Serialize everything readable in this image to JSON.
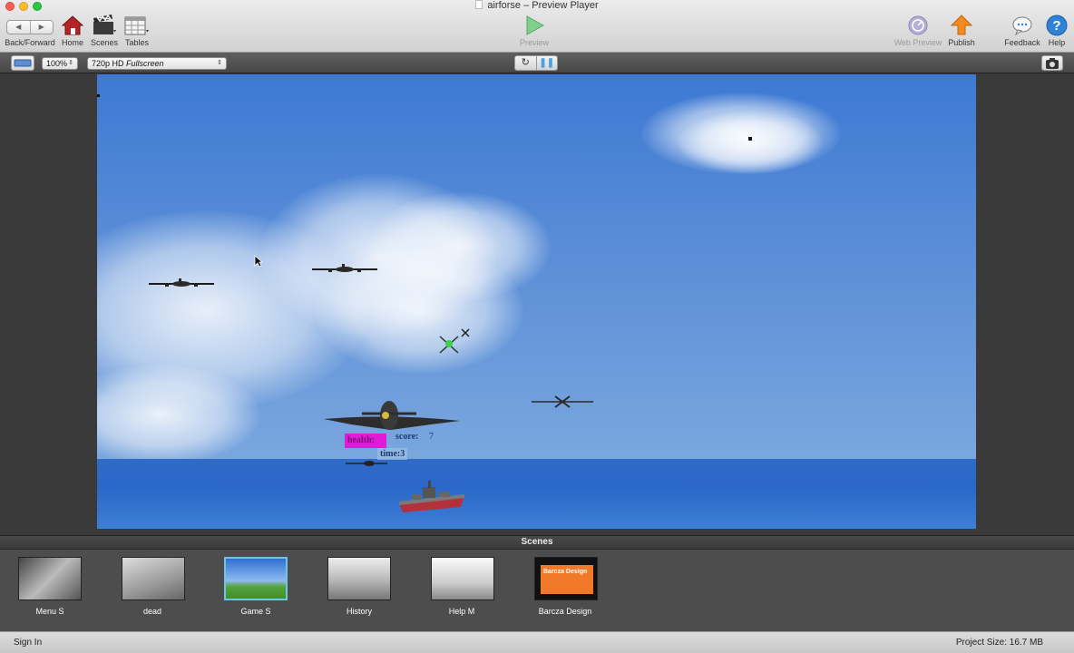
{
  "window": {
    "title": "airforse – Preview Player"
  },
  "toolbar": {
    "back_forward_label": "Back/Forward",
    "home_label": "Home",
    "scenes_label": "Scenes",
    "tables_label": "Tables",
    "preview_label": "Preview",
    "web_preview_label": "Web Preview",
    "publish_label": "Publish",
    "feedback_label": "Feedback",
    "help_label": "Help"
  },
  "subbar": {
    "zoom": "100%",
    "resolution_prefix": "720p HD",
    "resolution_suffix": "Fullscreen"
  },
  "game": {
    "health_label": "health:",
    "score_label": "score:",
    "score_value": "7",
    "time_label": "time:",
    "time_value": "3"
  },
  "scenes": {
    "header": "Scenes",
    "items": [
      {
        "label": "Menu S"
      },
      {
        "label": "dead"
      },
      {
        "label": "Game S"
      },
      {
        "label": "History"
      },
      {
        "label": "Help M"
      },
      {
        "label": "Barcza Design"
      }
    ],
    "thumb_text": {
      "barcza": "Barcza Design"
    }
  },
  "status": {
    "sign_in": "Sign In",
    "project_size": "Project Size: 16.7 MB"
  },
  "colors": {
    "selection": "#6cc7e6",
    "health_bar": "#e11ad8",
    "publish": "#f28a1e",
    "help": "#2f82d6"
  }
}
